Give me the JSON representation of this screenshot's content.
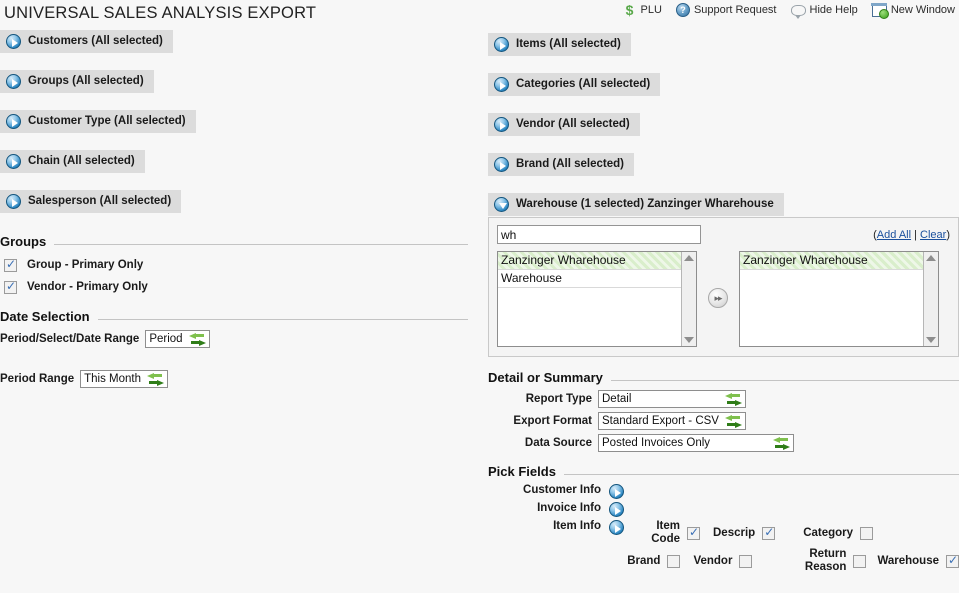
{
  "page": {
    "title": "UNIVERSAL SALES ANALYSIS EXPORT"
  },
  "toolbar": {
    "items": [
      {
        "label": "PLU",
        "icon": "dollar-icon"
      },
      {
        "label": "Support Request",
        "icon": "question-circle-icon"
      },
      {
        "label": "Hide Help",
        "icon": "speech-bubble-icon"
      },
      {
        "label": "New Window",
        "icon": "new-window-icon"
      }
    ]
  },
  "left": {
    "accordions": [
      {
        "label": "Customers (All selected)",
        "expanded": false
      },
      {
        "label": "Groups (All selected)",
        "expanded": false
      },
      {
        "label": "Customer Type (All selected)",
        "expanded": false
      },
      {
        "label": "Chain (All selected)",
        "expanded": false
      },
      {
        "label": "Salesperson (All selected)",
        "expanded": false
      }
    ],
    "groups_section": {
      "heading": "Groups",
      "checkboxes": [
        {
          "label": "Group - Primary Only",
          "checked": true
        },
        {
          "label": "Vendor - Primary Only",
          "checked": true
        }
      ]
    },
    "date_section": {
      "heading": "Date Selection",
      "fields": [
        {
          "label": "Period/Select/Date Range",
          "value": "Period"
        },
        {
          "label": "Period Range",
          "value": "This Month"
        }
      ]
    }
  },
  "right": {
    "accordions": [
      {
        "label": "Items (All selected)",
        "expanded": false
      },
      {
        "label": "Categories (All selected)",
        "expanded": false
      },
      {
        "label": "Vendor (All selected)",
        "expanded": false
      },
      {
        "label": "Brand (All selected)",
        "expanded": false
      },
      {
        "label": "Warehouse (1 selected) Zanzinger Wharehouse",
        "expanded": true
      }
    ],
    "picker": {
      "search_value": "wh",
      "search_placeholder": "",
      "add_all_label": "Add All",
      "clear_label": "Clear",
      "separator": " | ",
      "open_paren": "(",
      "close_paren": ")",
      "available": [
        {
          "label": "Zanzinger Wharehouse",
          "selected": true
        },
        {
          "label": "Warehouse",
          "selected": false
        }
      ],
      "chosen": [
        {
          "label": "Zanzinger Wharehouse",
          "selected": true
        }
      ],
      "transfer_label": "▸▸"
    },
    "detail_section": {
      "heading": "Detail or Summary",
      "fields": [
        {
          "label": "Report Type",
          "value": "Detail"
        },
        {
          "label": "Export Format",
          "value": "Standard Export - CSV"
        },
        {
          "label": "Data Source",
          "value": "Posted Invoices Only"
        }
      ]
    },
    "pick_fields": {
      "heading": "Pick Fields",
      "rows": [
        {
          "label": "Customer Info"
        },
        {
          "label": "Invoice Info"
        },
        {
          "label": "Item Info"
        }
      ],
      "checkboxes_row1": [
        {
          "label": "Item Code",
          "checked": true
        },
        {
          "label": "Descrip",
          "checked": true
        },
        {
          "label": "Category",
          "checked": false
        }
      ],
      "checkboxes_row2": [
        {
          "label": "Brand",
          "checked": false
        },
        {
          "label": "Vendor",
          "checked": false
        },
        {
          "label": "Return Reason",
          "checked": false
        },
        {
          "label": "Warehouse",
          "checked": true
        }
      ]
    }
  },
  "colors": {
    "background": "#f7f7f7",
    "pill": "#dcdcdc",
    "accent_blue": "#2e89c4",
    "link": "#1a4f9c",
    "select_green": "#d9eecb",
    "swap_green": "#2f7d18"
  }
}
